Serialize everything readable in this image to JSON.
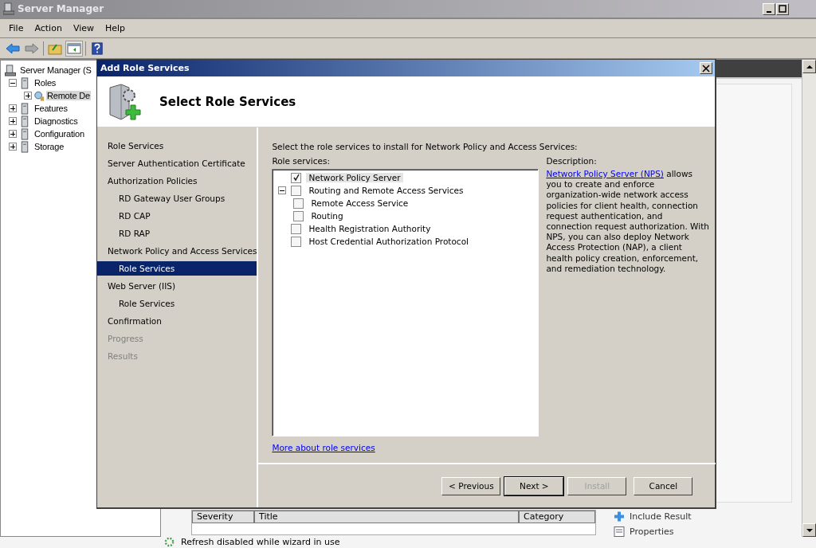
{
  "window": {
    "title": "Server Manager"
  },
  "menu": [
    "File",
    "Action",
    "View",
    "Help"
  ],
  "tree": {
    "root": "Server Manager (S",
    "items": [
      {
        "label": "Roles",
        "expanded": true,
        "selected": false,
        "children": [
          {
            "label": "Remote De",
            "expanded": false,
            "selected": true
          }
        ]
      },
      {
        "label": "Features",
        "expanded": false,
        "selected": false
      },
      {
        "label": "Diagnostics",
        "expanded": false,
        "selected": false
      },
      {
        "label": "Configuration",
        "expanded": false,
        "selected": false
      },
      {
        "label": "Storage",
        "expanded": false,
        "selected": false
      }
    ]
  },
  "results_table": {
    "columns": [
      "Severity",
      "Title",
      "Category"
    ]
  },
  "tasks": [
    "Include Result",
    "Properties"
  ],
  "status_bar": "Refresh disabled while wizard in use",
  "dialog": {
    "title": "Add Role Services",
    "heading": "Select Role Services",
    "steps": [
      {
        "label": "Role Services",
        "selected": false,
        "disabled": false
      },
      {
        "label": "Server Authentication Certificate",
        "selected": false,
        "disabled": false
      },
      {
        "label": "Authorization Policies",
        "selected": false,
        "disabled": false,
        "children": [
          {
            "label": "RD Gateway User Groups",
            "selected": false,
            "disabled": false
          },
          {
            "label": "RD CAP",
            "selected": false,
            "disabled": false
          },
          {
            "label": "RD RAP",
            "selected": false,
            "disabled": false
          }
        ]
      },
      {
        "label": "Network Policy and Access Services",
        "selected": false,
        "disabled": false,
        "children": [
          {
            "label": "Role Services",
            "selected": true,
            "disabled": false
          }
        ]
      },
      {
        "label": "Web Server (IIS)",
        "selected": false,
        "disabled": false,
        "children": [
          {
            "label": "Role Services",
            "selected": false,
            "disabled": false
          }
        ]
      },
      {
        "label": "Confirmation",
        "selected": false,
        "disabled": false
      },
      {
        "label": "Progress",
        "selected": false,
        "disabled": true
      },
      {
        "label": "Results",
        "selected": false,
        "disabled": true
      }
    ],
    "instruction": "Select the role services to install for Network Policy and Access Services:",
    "list_label": "Role services:",
    "services": [
      {
        "label": "Network Policy Server",
        "checked": true,
        "selected": true
      },
      {
        "label": "Routing and Remote Access Services",
        "checked": false,
        "selected": false,
        "expanded": true,
        "children": [
          {
            "label": "Remote Access Service",
            "checked": false,
            "selected": false
          },
          {
            "label": "Routing",
            "checked": false,
            "selected": false
          }
        ]
      },
      {
        "label": "Health Registration Authority",
        "checked": false,
        "selected": false
      },
      {
        "label": "Host Credential Authorization Protocol",
        "checked": false,
        "selected": false
      }
    ],
    "description": {
      "label": "Description:",
      "link": "Network Policy Server (NPS)",
      "text": " allows you to create and enforce organization-wide network access policies for client health, connection request authentication, and connection request authorization. With NPS, you can also deploy Network Access Protection (NAP), a client health policy creation, enforcement, and remediation technology."
    },
    "more_link": "More about role services",
    "buttons": [
      {
        "label": "< Previous",
        "disabled": false,
        "default": false
      },
      {
        "label": "Next >",
        "disabled": false,
        "default": true
      },
      {
        "label": "Install",
        "disabled": true,
        "default": false
      },
      {
        "label": "Cancel",
        "disabled": false,
        "default": false
      }
    ]
  }
}
